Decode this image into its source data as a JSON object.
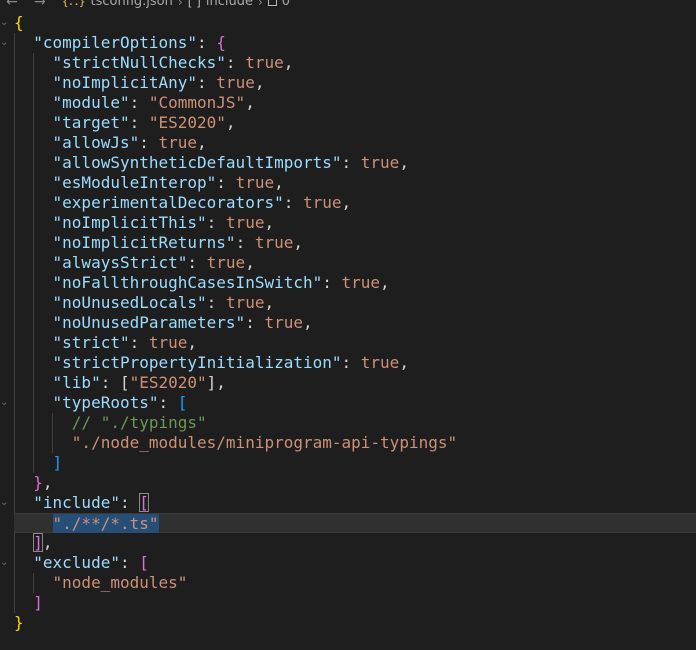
{
  "breadcrumb": {
    "back_arrow": "←",
    "forward_arrow": "→",
    "file_icon": "{..}",
    "file_name": "tsconfig.json",
    "sep": "›",
    "array_icon": "[ ]",
    "include": "include",
    "index": "0"
  },
  "icons": {
    "fold_open": "⌄"
  },
  "colors": {
    "background": "#1e1e1e",
    "key": "#9cdcfe",
    "string": "#ce9178",
    "outer_brace": "#ffd700",
    "bracket_pink": "#da70d6",
    "bracket_blue": "#179fff",
    "comment": "#6a9955"
  },
  "code": {
    "open_brace": "{",
    "close_brace": "}",
    "compilerOptions_key": "\"compilerOptions\"",
    "options": [
      {
        "key": "\"strictNullChecks\"",
        "value": "true"
      },
      {
        "key": "\"noImplicitAny\"",
        "value": "true"
      },
      {
        "key": "\"module\"",
        "value": "\"CommonJS\""
      },
      {
        "key": "\"target\"",
        "value": "\"ES2020\""
      },
      {
        "key": "\"allowJs\"",
        "value": "true"
      },
      {
        "key": "\"allowSyntheticDefaultImports\"",
        "value": "true"
      },
      {
        "key": "\"esModuleInterop\"",
        "value": "true"
      },
      {
        "key": "\"experimentalDecorators\"",
        "value": "true"
      },
      {
        "key": "\"noImplicitThis\"",
        "value": "true"
      },
      {
        "key": "\"noImplicitReturns\"",
        "value": "true"
      },
      {
        "key": "\"alwaysStrict\"",
        "value": "true"
      },
      {
        "key": "\"noFallthroughCasesInSwitch\"",
        "value": "true"
      },
      {
        "key": "\"noUnusedLocals\"",
        "value": "true"
      },
      {
        "key": "\"noUnusedParameters\"",
        "value": "true"
      },
      {
        "key": "\"strict\"",
        "value": "true"
      },
      {
        "key": "\"strictPropertyInitialization\"",
        "value": "true"
      }
    ],
    "lib_key": "\"lib\"",
    "lib_value": "\"ES2020\"",
    "typeRoots_key": "\"typeRoots\"",
    "typeRoots_comment": "// \"./typings\"",
    "typeRoots_value": "\"./node_modules/miniprogram-api-typings\"",
    "include_key": "\"include\"",
    "include_value": "\"./**/*.ts\"",
    "exclude_key": "\"exclude\"",
    "exclude_value": "\"node_modules\""
  }
}
